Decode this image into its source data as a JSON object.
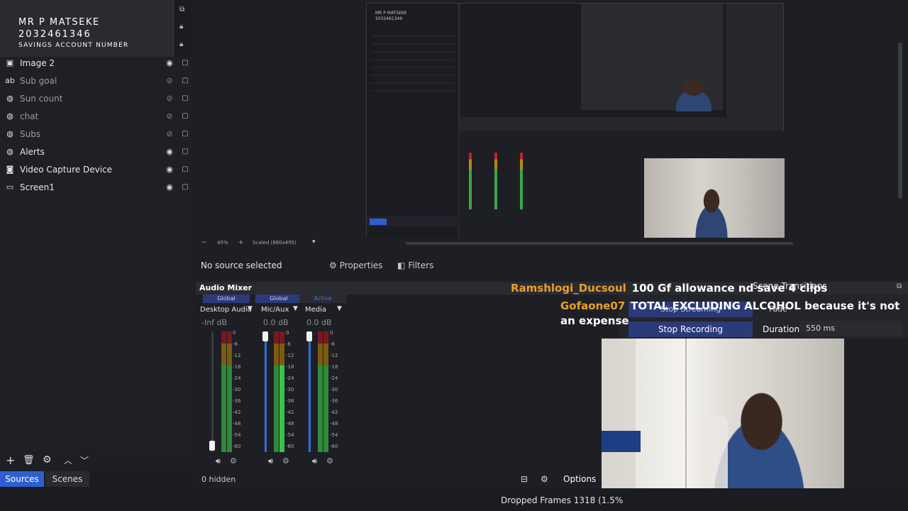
{
  "overlay": {
    "name": "MR P MATSEKE",
    "number": "2032461346",
    "label": "SAVINGS ACCOUNT NUMBER"
  },
  "sources": [
    {
      "name": "Image 2",
      "icon": "image-icon",
      "visible": true
    },
    {
      "name": "Sub goal",
      "icon": "text-icon",
      "visible": false
    },
    {
      "name": "Sun count",
      "icon": "browser-icon",
      "visible": false
    },
    {
      "name": "chat",
      "icon": "browser-icon",
      "visible": false
    },
    {
      "name": "Subs",
      "icon": "browser-icon",
      "visible": false
    },
    {
      "name": "Alerts",
      "icon": "browser-icon",
      "visible": true
    },
    {
      "name": "Video Capture Device",
      "icon": "camera-icon",
      "visible": true
    },
    {
      "name": "Screen1",
      "icon": "monitor-icon",
      "visible": true
    }
  ],
  "preview_toolbar": {
    "zoom": "45%",
    "scaled": "Scaled (880x495)"
  },
  "properties_bar": {
    "no_source": "No source selected",
    "properties": "Properties",
    "filters": "Filters"
  },
  "mixer": {
    "title": "Audio Mixer",
    "channels": [
      {
        "tag": "Global",
        "name": "Desktop Audio",
        "db": "-Inf dB",
        "level": 0.0
      },
      {
        "tag": "Global",
        "name": "Mic/Aux",
        "db": "0.0 dB",
        "level": 1.0
      },
      {
        "tag": "Active",
        "name": "Media",
        "db": "0.0 dB",
        "level": 1.0
      }
    ],
    "scale": [
      "0",
      "-6",
      "-12",
      "-18",
      "-24",
      "-30",
      "-36",
      "-42",
      "-48",
      "-54",
      "-60"
    ]
  },
  "chat": {
    "user1": "Ramshlogi_Ducsoul",
    "msg1": "100 Gf allowance nd save 4 clips",
    "user2": "Gofaone07",
    "msg2": "TOTAL EXCLUDING ALCOHOL because it's not an expense"
  },
  "controls": {
    "transitions": "Scene Transitions",
    "stop_streaming": "Stop Streaming",
    "fade": "Fade",
    "stop_recording": "Stop Recording",
    "duration_label": "Duration",
    "duration_value": "550 ms"
  },
  "dock": {
    "hidden": "0 hidden",
    "options": "Options"
  },
  "tabs": {
    "sources": "Sources",
    "scenes": "Scenes"
  },
  "footer": {
    "dropped": "Dropped Frames 1318 (1.5%"
  },
  "colors": {
    "accent": "#2b3a78",
    "active_tab": "#2e5fd1",
    "chat_user": "#e8a02a"
  }
}
